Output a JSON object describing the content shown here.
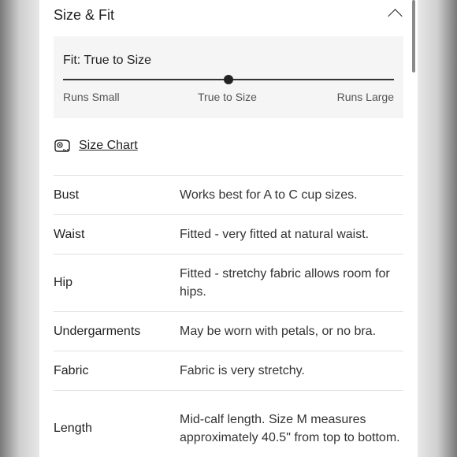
{
  "section": {
    "title": "Size & Fit"
  },
  "fit": {
    "label": "Fit: True to Size",
    "scale_labels": [
      "Runs Small",
      "True to Size",
      "Runs Large"
    ],
    "position": 0.5
  },
  "size_chart": {
    "label": "Size Chart"
  },
  "rows": [
    {
      "label": "Bust",
      "value": "Works best for A to C cup sizes."
    },
    {
      "label": "Waist",
      "value": "Fitted - very fitted at natural waist."
    },
    {
      "label": "Hip",
      "value": "Fitted - stretchy fabric allows room for hips."
    },
    {
      "label": "Undergarments",
      "value": "May be worn with petals, or no bra."
    },
    {
      "label": "Fabric",
      "value": "Fabric is very stretchy."
    },
    {
      "label": "Length",
      "value": "Mid-calf length. Size M measures approximately 40.5\" from top to bottom."
    }
  ]
}
